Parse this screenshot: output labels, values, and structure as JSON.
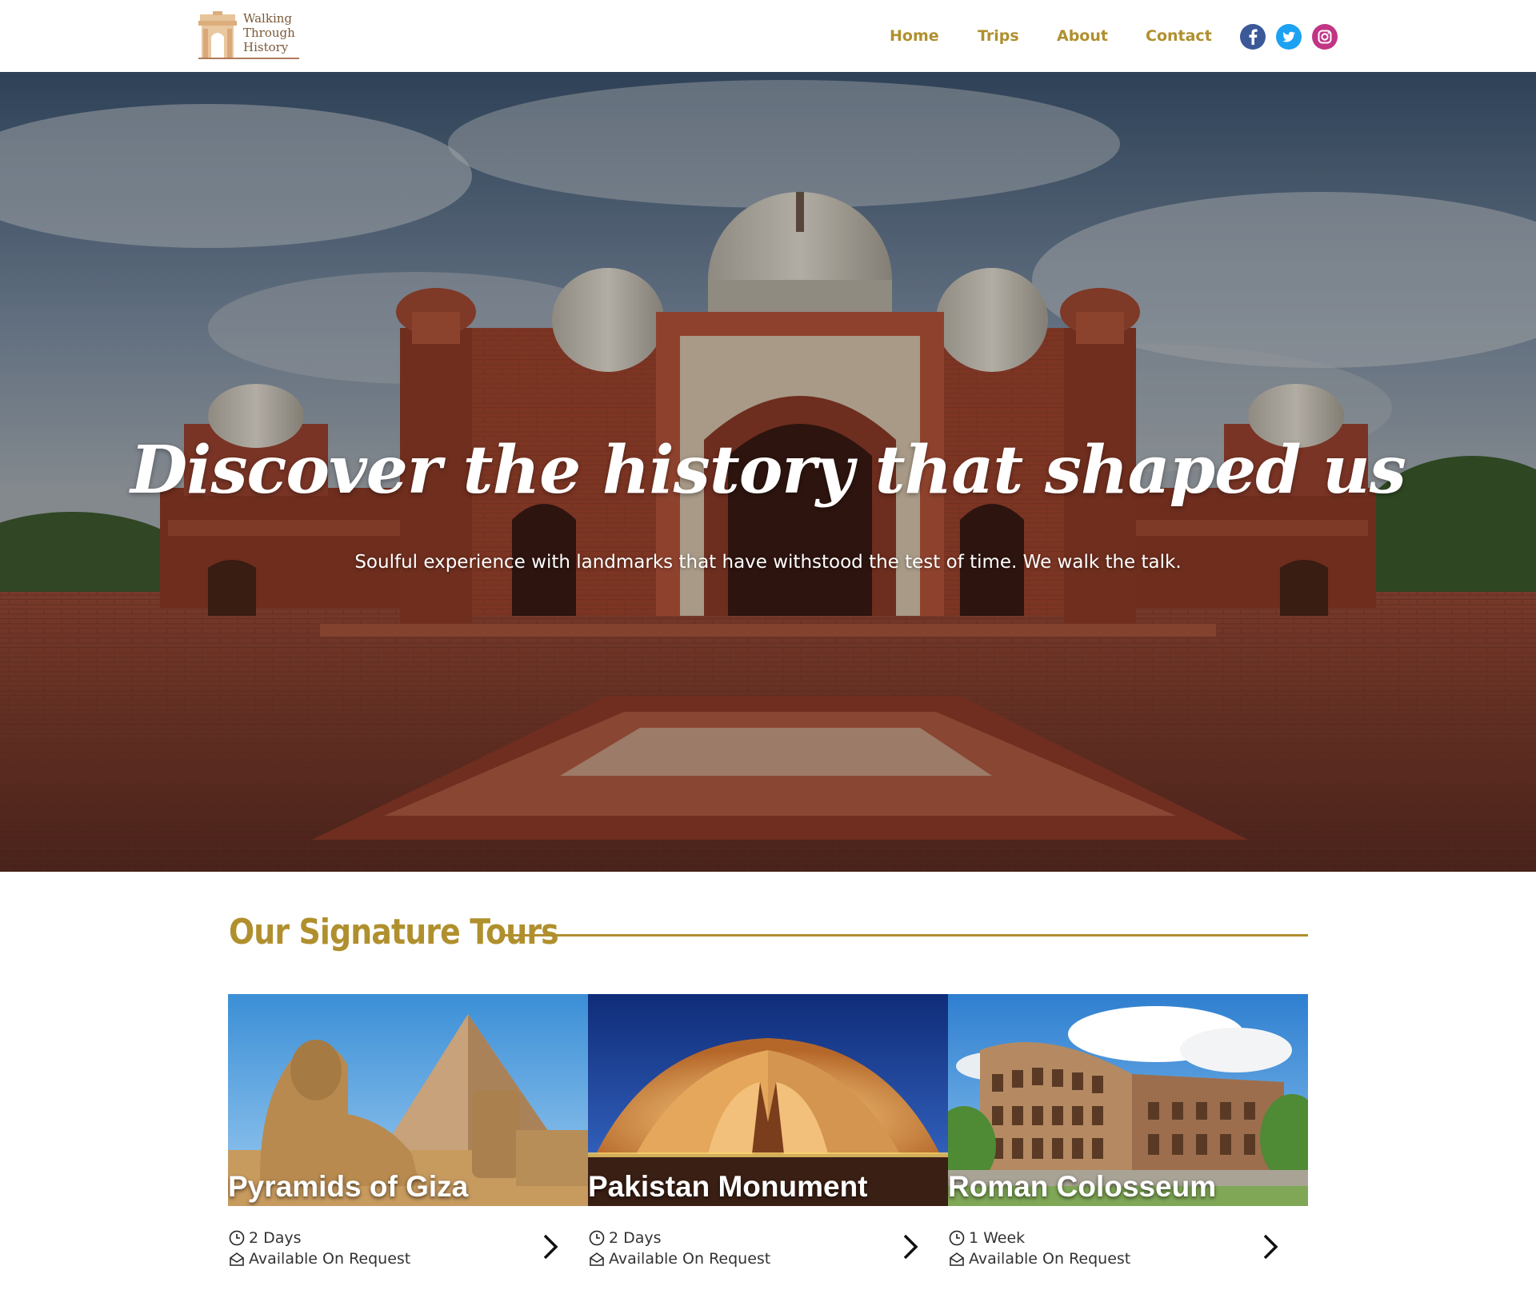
{
  "brand": {
    "logo_lines": [
      "Walking",
      "Through",
      "History"
    ]
  },
  "nav": {
    "items": [
      {
        "label": "Home"
      },
      {
        "label": "Trips"
      },
      {
        "label": "About"
      },
      {
        "label": "Contact"
      }
    ]
  },
  "social": {
    "icons": [
      "facebook-icon",
      "twitter-icon",
      "instagram-icon"
    ],
    "colors": {
      "facebook": "#3b5998",
      "twitter": "#1da1f2",
      "instagram": "#c13584"
    }
  },
  "hero": {
    "title": "Discover the history that shaped us",
    "subtitle": "Soulful experience with landmarks that have withstood the test of time. We walk the talk."
  },
  "tours": {
    "section_title": "Our Signature Tours",
    "cards": [
      {
        "title": "Pyramids of Giza",
        "duration": "2 Days",
        "availability": "Available On Request"
      },
      {
        "title": "Pakistan Monument",
        "duration": "2 Days",
        "availability": "Available On Request"
      },
      {
        "title": "Roman Colosseum",
        "duration": "1 Week",
        "availability": "Available On Request"
      }
    ]
  },
  "colors": {
    "accent": "#b0902e",
    "logo_brown": "#7a5a3a"
  }
}
